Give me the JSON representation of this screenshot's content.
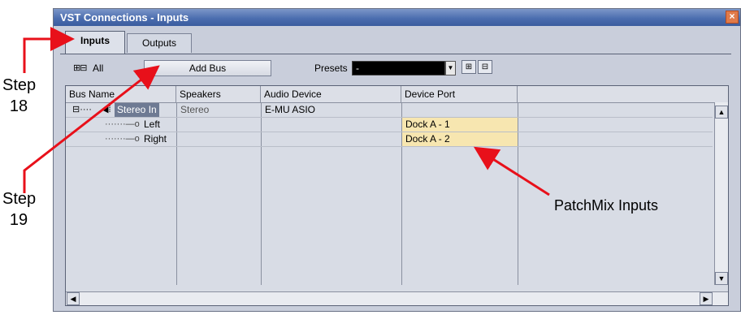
{
  "window": {
    "title": "VST Connections - Inputs",
    "close_glyph": "×"
  },
  "tabs": [
    {
      "label": "Inputs",
      "active": true
    },
    {
      "label": "Outputs",
      "active": false
    }
  ],
  "toolbar": {
    "expand_icons": "⊞⊟",
    "all_label": "All",
    "add_bus_label": "Add Bus",
    "presets_label": "Presets",
    "presets_value": "-",
    "preset_store_icon": "store-preset-icon",
    "preset_remove_icon": "remove-preset-icon"
  },
  "grid": {
    "columns": [
      "Bus Name",
      "Speakers",
      "Audio Device",
      "Device Port"
    ],
    "rows": [
      {
        "bus_name": "Stereo In",
        "speakers": "Stereo",
        "audio_device": "E-MU ASIO",
        "device_port": ""
      },
      {
        "bus_name": "Left",
        "speakers": "",
        "audio_device": "",
        "device_port": "Dock A - 1"
      },
      {
        "bus_name": "Right",
        "speakers": "",
        "audio_device": "",
        "device_port": "Dock A - 2"
      }
    ]
  },
  "annotations": {
    "step18": [
      "Step",
      "18"
    ],
    "step19": [
      "Step",
      "19"
    ],
    "patchmix": "PatchMix Inputs",
    "arrow_color": "#e8101a"
  }
}
